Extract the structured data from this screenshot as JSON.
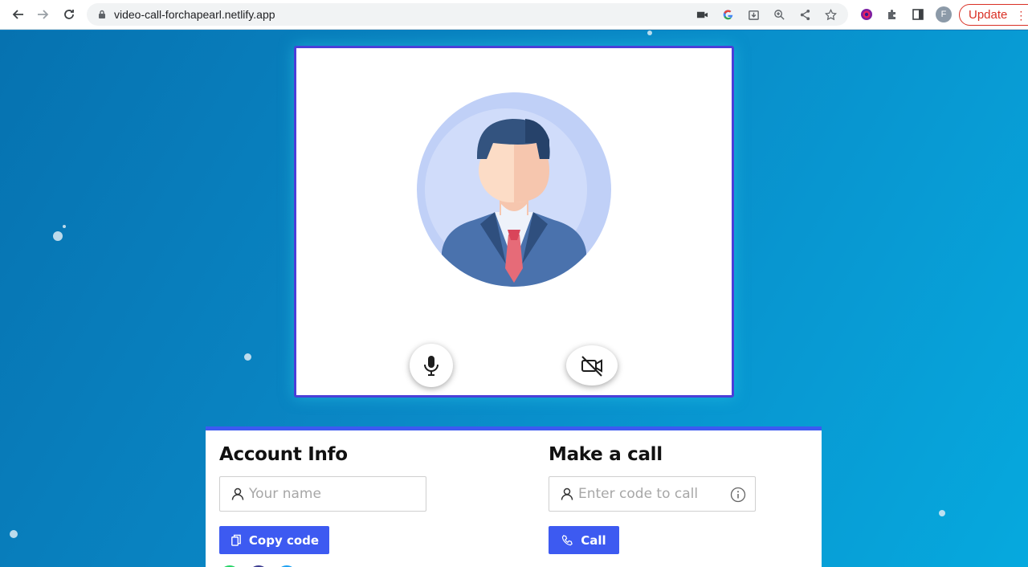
{
  "browser": {
    "url": "video-call-forchapearl.netlify.app",
    "profile_initial": "F",
    "update_label": "Update",
    "update_menu": "⋮"
  },
  "video": {
    "mic_icon": "microphone-icon",
    "camera_icon": "video-off-icon"
  },
  "account": {
    "title": "Account Info",
    "name_placeholder": "Your name",
    "copy_label": "Copy code"
  },
  "call": {
    "title": "Make a call",
    "code_placeholder": "Enter code to call",
    "call_label": "Call"
  },
  "colors": {
    "accent": "#3d5af1",
    "card_border": "#4b3fd8",
    "update_red": "#d93025"
  }
}
